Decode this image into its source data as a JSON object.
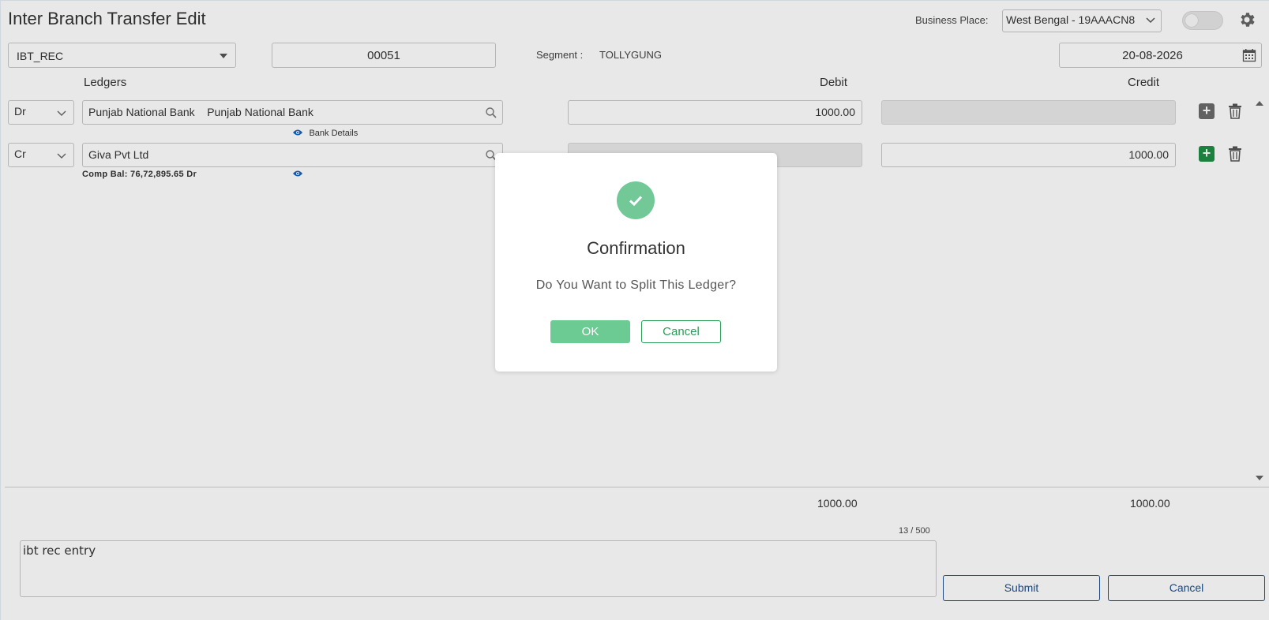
{
  "page": {
    "title": "Inter Branch Transfer Edit"
  },
  "header": {
    "business_place_label": "Business Place:",
    "business_place_value": "West Bengal - 19AAACN8",
    "toggle_on": false
  },
  "voucher": {
    "type": "IBT_REC",
    "number": "00051",
    "segment_label": "Segment :",
    "segment_value": "TOLLYGUNG",
    "date": "20-08-2026"
  },
  "columns": {
    "ledgers": "Ledgers",
    "debit": "Debit",
    "credit": "Credit"
  },
  "rows": [
    {
      "drcr": "Dr",
      "ledger": "Punjab National Bank    Punjab National Bank",
      "debit": "1000.00",
      "credit": "",
      "sub_link": "Bank Details"
    },
    {
      "drcr": "Cr",
      "ledger": "Giva Pvt Ltd",
      "debit": "",
      "credit": "1000.00",
      "comp_bal": "Comp Bal: 76,72,895.65 Dr"
    }
  ],
  "totals": {
    "debit": "1000.00",
    "credit": "1000.00"
  },
  "narration": {
    "value": "ibt rec entry",
    "char_count": "13 / 500"
  },
  "actions": {
    "submit": "Submit",
    "cancel": "Cancel"
  },
  "dialog": {
    "title": "Confirmation",
    "message": "Do You Want to Split This Ledger?",
    "ok": "OK",
    "cancel": "Cancel"
  },
  "colors": {
    "success_green": "#72c997",
    "add_green": "#1f8e45",
    "primary_blue": "#1f4e8c"
  }
}
